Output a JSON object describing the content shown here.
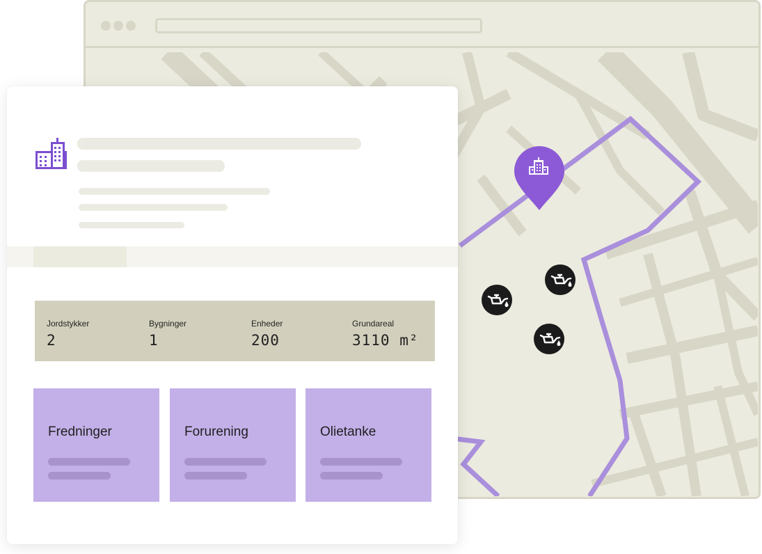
{
  "stats": [
    {
      "label": "Jordstykker",
      "value": "2"
    },
    {
      "label": "Bygninger",
      "value": "1"
    },
    {
      "label": "Enheder",
      "value": "200"
    },
    {
      "label": "Grundareal",
      "value": "3110 m²"
    }
  ],
  "cards": [
    {
      "title": "Fredninger"
    },
    {
      "title": "Forurening"
    },
    {
      "title": "Olietanke"
    }
  ],
  "map": {
    "location_marker_icon": "building-icon",
    "poi_icon": "oil-can-icon",
    "boundary_color": "#a98fdc",
    "marker_color": "#8c5ad6"
  },
  "colors": {
    "accent": "#7b4fd0",
    "card_bg": "#c3b0e8",
    "stats_bg": "#d2d0bc",
    "map_bg": "#ecebdf",
    "road": "#d8d6c6"
  }
}
